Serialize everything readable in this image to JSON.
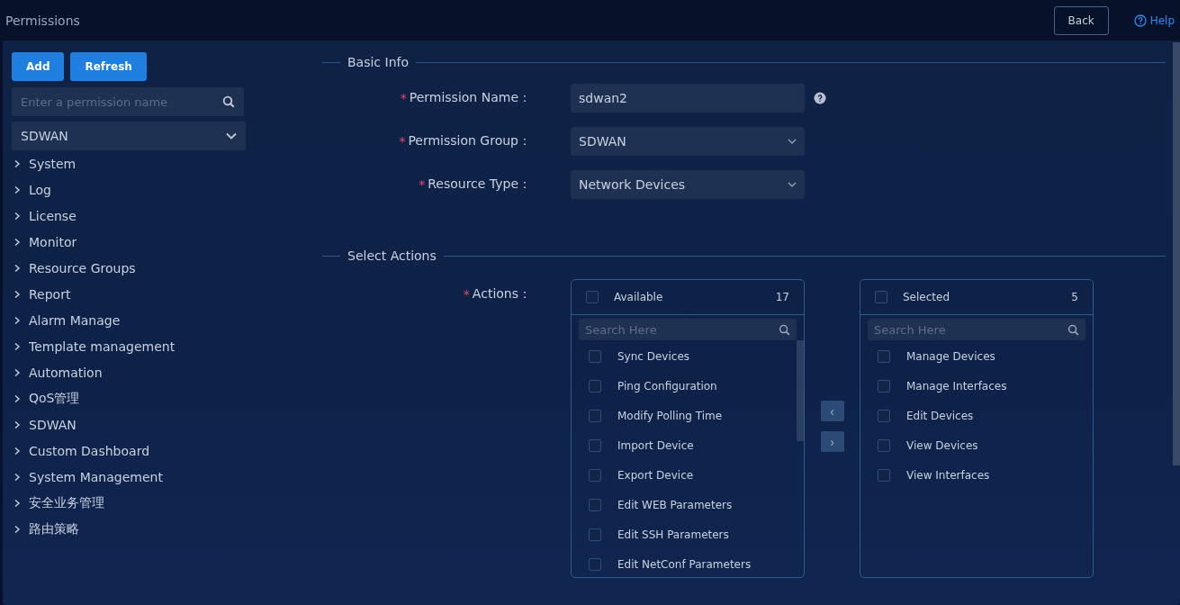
{
  "header": {
    "title": "Permissions",
    "back_button": "Back",
    "help_link": "Help"
  },
  "sidebar": {
    "add_button": "Add",
    "refresh_button": "Refresh",
    "search": {
      "placeholder": "Enter a permission name"
    },
    "group_select": "SDWAN",
    "items": [
      {
        "label": "System",
        "expanded": false
      },
      {
        "label": "Log",
        "expanded": false
      },
      {
        "label": "License",
        "expanded": false
      },
      {
        "label": "Monitor",
        "expanded": false
      },
      {
        "label": "Resource Groups",
        "expanded": false
      },
      {
        "label": "Report",
        "expanded": false
      },
      {
        "label": "Alarm Manage",
        "expanded": false
      },
      {
        "label": "Template management",
        "expanded": false
      },
      {
        "label": "Automation",
        "expanded": false
      },
      {
        "label": "QoS管理",
        "expanded": false
      },
      {
        "label": "SDWAN",
        "expanded": false
      },
      {
        "label": "Custom Dashboard",
        "expanded": false
      },
      {
        "label": "System Management",
        "expanded": false
      },
      {
        "label": "安全业务管理",
        "expanded": false
      },
      {
        "label": "路由策略",
        "expanded": false
      }
    ]
  },
  "basic_info": {
    "title": "Basic Info",
    "fields": [
      {
        "kind": "input",
        "label": "Permission Name：",
        "required_mark": "*",
        "value": "sdwan2",
        "help": true
      },
      {
        "kind": "select",
        "label": "Permission Group：",
        "required_mark": "*",
        "value": "SDWAN",
        "help": false
      },
      {
        "kind": "select",
        "label": "Resource Type：",
        "required_mark": "*",
        "value": "Network Devices",
        "help": false
      }
    ]
  },
  "select_actions": {
    "title": "Select Actions",
    "label": "Actions：",
    "required_mark": "*",
    "available": {
      "title": "Available",
      "count": "17",
      "checked": false,
      "search": {
        "placeholder": "Search Here"
      },
      "items": [
        {
          "label": "Sync Devices",
          "checked": false
        },
        {
          "label": "Ping Configuration",
          "checked": false
        },
        {
          "label": "Modify Polling Time",
          "checked": false
        },
        {
          "label": "Import Device",
          "checked": false
        },
        {
          "label": "Export Device",
          "checked": false
        },
        {
          "label": "Edit WEB Parameters",
          "checked": false
        },
        {
          "label": "Edit SSH Parameters",
          "checked": false
        },
        {
          "label": "Edit NetConf Parameters",
          "checked": false
        }
      ]
    },
    "move_left": "‹",
    "move_right": "›",
    "selected": {
      "title": "Selected",
      "count": "5",
      "checked": false,
      "search": {
        "placeholder": "Search Here"
      },
      "items": [
        {
          "label": "Manage Devices",
          "checked": false
        },
        {
          "label": "Manage Interfaces",
          "checked": false
        },
        {
          "label": "Edit Devices",
          "checked": false
        },
        {
          "label": "View Devices",
          "checked": false
        },
        {
          "label": "View Interfaces",
          "checked": false
        }
      ]
    }
  }
}
